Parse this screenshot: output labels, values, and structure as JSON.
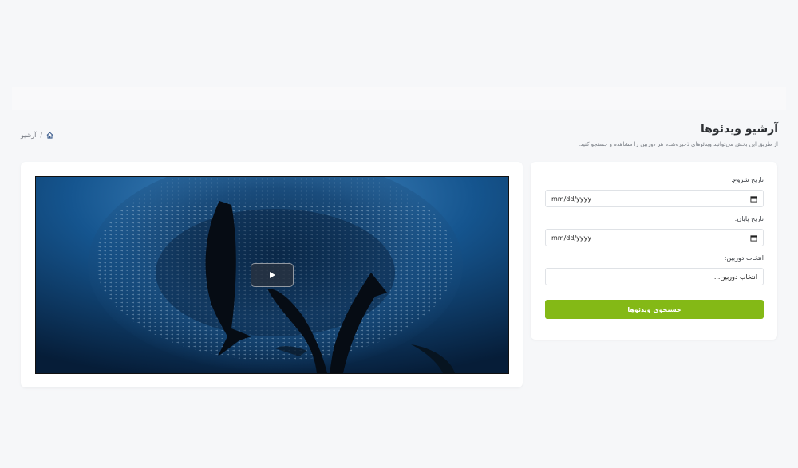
{
  "header": {
    "title": "آرشیو ویدئوها",
    "description": "از طریق این بخش می‌توانید ویدئوهای ذخیره‌شده هر دوربین را مشاهده و جستجو کنید."
  },
  "breadcrumb": {
    "home_icon": "home-icon",
    "separator": "/",
    "current": "آرشیو"
  },
  "form": {
    "start_date_label": "تاریخ شروع:",
    "start_date_value": "mm/dd/yyyy",
    "end_date_label": "تاریخ پایان:",
    "end_date_value": "mm/dd/yyyy",
    "camera_label": "انتخاب دوربین:",
    "camera_placeholder": "انتخاب دوربین...",
    "submit_label": "جستجوی ویدئوها",
    "accent_color": "#84b916"
  },
  "video": {
    "play_icon": "play-icon"
  }
}
